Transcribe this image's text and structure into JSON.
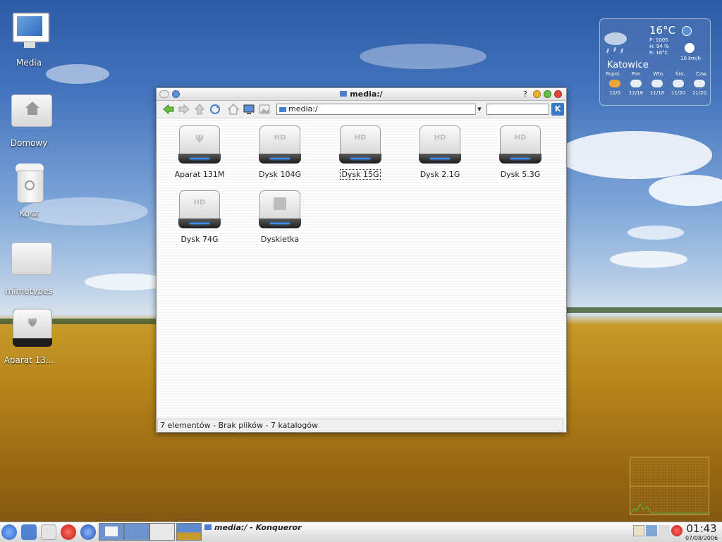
{
  "desktop": {
    "icons": [
      {
        "label": "Media"
      },
      {
        "label": "Domowy"
      },
      {
        "label": "Kosz"
      },
      {
        "label": "mimetypes"
      },
      {
        "label": "Aparat 13..."
      }
    ]
  },
  "weather": {
    "temperature": "16°C",
    "pressure": "P: 1005",
    "humidity": "H: 94 %",
    "realfeel": "R: 16°C",
    "city": "Katowice",
    "wind": "10 km/h",
    "days": [
      "Popol.",
      "Pon.",
      "Wto.",
      "Śro.",
      "Czw."
    ],
    "forecast": [
      "12/0",
      "12/18",
      "11/18",
      "11/20",
      "11/20"
    ]
  },
  "window": {
    "title": "media:/",
    "help": "?",
    "url": "media:/",
    "search_value": "",
    "files": [
      {
        "label": "Aparat 131M",
        "type": "usb"
      },
      {
        "label": "Dysk 104G",
        "type": "hd"
      },
      {
        "label": "Dysk 15G",
        "type": "hd"
      },
      {
        "label": "Dysk 2.1G",
        "type": "hd"
      },
      {
        "label": "Dysk 5.3G",
        "type": "hd"
      },
      {
        "label": "Dysk 74G",
        "type": "hd"
      },
      {
        "label": "Dyskietka",
        "type": "floppy"
      }
    ],
    "status": "7 elementów - Brak plików - 7 katalogów"
  },
  "taskbar": {
    "task_title": "media:/ - Konqueror",
    "time": "01:43",
    "date": "07/08/2006"
  },
  "colors": {
    "accent_blue": "#3a78c8",
    "led_blue": "#3b8cff",
    "close_red": "#e0443a",
    "min_yellow": "#f0b030",
    "max_green": "#5cc040"
  }
}
